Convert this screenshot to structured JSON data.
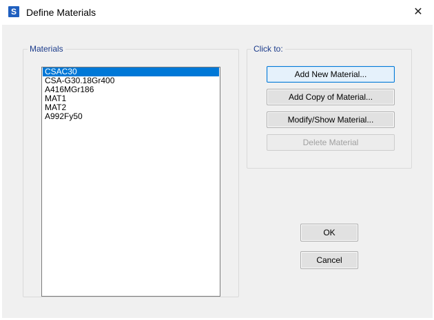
{
  "window": {
    "app_icon_letter": "S",
    "title": "Define Materials",
    "close_glyph": "✕"
  },
  "materials_group": {
    "label": "Materials",
    "items": [
      {
        "name": "CSAC30",
        "selected": true
      },
      {
        "name": "CSA-G30.18Gr400",
        "selected": false
      },
      {
        "name": "A416MGr186",
        "selected": false
      },
      {
        "name": "MAT1",
        "selected": false
      },
      {
        "name": "MAT2",
        "selected": false
      },
      {
        "name": "A992Fy50",
        "selected": false
      }
    ]
  },
  "click_to_group": {
    "label": "Click to:",
    "add_new_label": "Add New Material...",
    "add_copy_label": "Add Copy of Material...",
    "modify_label": "Modify/Show Material...",
    "delete_label": "Delete Material"
  },
  "dialog_buttons": {
    "ok_label": "OK",
    "cancel_label": "Cancel"
  },
  "colors": {
    "selection": "#0078d7",
    "group_label": "#1a3a8a",
    "app_icon": "#1f5fbf"
  }
}
